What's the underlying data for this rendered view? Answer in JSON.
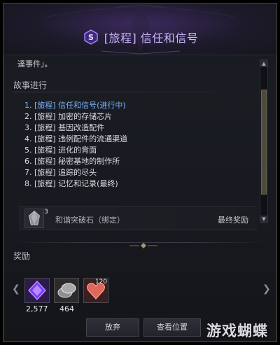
{
  "header": {
    "title": "[旅程] 信任和信号",
    "icon": "quest-s-badge-icon",
    "accent_color": "#c9b4ff"
  },
  "overflow_text": "達事件」。",
  "story": {
    "section_title": "故事进行",
    "items": [
      {
        "text": "1. [旅程] 信任和信号(进行中)",
        "current": true
      },
      {
        "text": "2. [旅程] 加密的存储芯片",
        "current": false
      },
      {
        "text": "3. [旅程] 基因改造配件",
        "current": false
      },
      {
        "text": "4. [旅程] 违例配件的流通渠道",
        "current": false
      },
      {
        "text": "5. [旅程] 进化的背面",
        "current": false
      },
      {
        "text": "6. [旅程] 秘密基地的制作所",
        "current": false
      },
      {
        "text": "7. [旅程] 追踪的尽头",
        "current": false
      },
      {
        "text": "8. [旅程] 记忆和记录(最终)",
        "current": false
      }
    ],
    "current_color": "#7ab7ff"
  },
  "final_reward": {
    "item_name": "和谐突破石（绑定）",
    "count": "3",
    "label": "最终奖励"
  },
  "rewards": {
    "section_title": "奖励",
    "items": [
      {
        "icon": "purple-crystal-icon",
        "quantity": "2,577"
      },
      {
        "icon": "silver-coins-icon",
        "quantity": "464"
      },
      {
        "icon": "red-heart-icon",
        "badge": "120"
      }
    ]
  },
  "buttons": {
    "abandon": "放弃",
    "view_location": "查看位置"
  },
  "watermark": "游戏蝴蝶"
}
